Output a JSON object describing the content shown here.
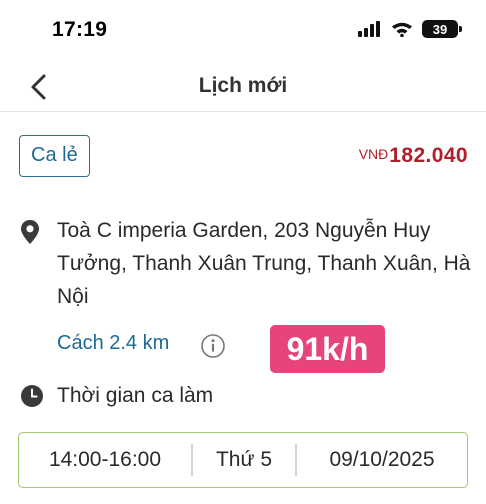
{
  "status_bar": {
    "time": "17:19",
    "battery": "39"
  },
  "nav": {
    "title": "Lịch mới"
  },
  "shift": {
    "type_tag": "Ca lẻ",
    "currency": "VNĐ",
    "price": "182.040",
    "address": "Toà C imperia Garden,  203 Nguyễn Huy Tưởng, Thanh Xuân Trung, Thanh Xuân, Hà Nội",
    "distance": "Cách 2.4 km",
    "speed_badge": "91k/h",
    "work_time_label": "Thời gian ca làm",
    "time_range": "14:00-16:00",
    "weekday": "Thứ 5",
    "date": "09/10/2025"
  },
  "colors": {
    "accent_blue": "#1f6a94",
    "price_red": "#b0202a",
    "badge_pink": "#e6457a",
    "box_green": "#a5c86a"
  },
  "icons": [
    "back-chevron-icon",
    "location-pin-icon",
    "info-icon",
    "clock-icon",
    "signal-icon",
    "wifi-icon",
    "battery-icon"
  ]
}
